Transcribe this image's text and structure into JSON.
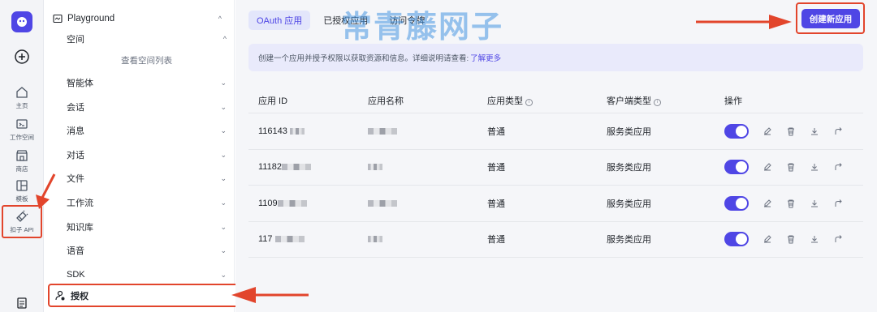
{
  "rail": {
    "items": [
      {
        "label": "主页",
        "icon": "home-icon"
      },
      {
        "label": "工作空间",
        "icon": "terminal-icon"
      },
      {
        "label": "商店",
        "icon": "store-icon"
      },
      {
        "label": "模板",
        "icon": "template-icon"
      },
      {
        "label": "扣子 API",
        "icon": "api-icon"
      }
    ]
  },
  "sidebar": {
    "header": "Playground",
    "items": [
      {
        "label": "空间",
        "caret": "^"
      },
      {
        "label": "智能体",
        "caret": "⌄"
      },
      {
        "label": "会话",
        "caret": "⌄"
      },
      {
        "label": "消息",
        "caret": "⌄"
      },
      {
        "label": "对话",
        "caret": "⌄"
      },
      {
        "label": "文件",
        "caret": "⌄"
      },
      {
        "label": "工作流",
        "caret": "⌄"
      },
      {
        "label": "知识库",
        "caret": "⌄"
      },
      {
        "label": "语音",
        "caret": "⌄"
      },
      {
        "label": "SDK",
        "caret": "⌄"
      }
    ],
    "sub_item": "查看空间列表",
    "auth_label": "授权"
  },
  "main": {
    "tabs": [
      {
        "label": "OAuth 应用"
      },
      {
        "label": "已授权应用"
      },
      {
        "label": "访问令牌"
      }
    ],
    "watermark": "常青藤网子",
    "create_button": "创建新应用",
    "notice_text": "创建一个应用并授予权限以获取资源和信息。详细说明请查看:",
    "notice_link": "了解更多",
    "table": {
      "headers": [
        "应用 ID",
        "应用名称",
        "应用类型",
        "客户端类型",
        "操作"
      ],
      "rows": [
        {
          "id": "116143",
          "name": "",
          "type": "普通",
          "client": "服务类应用"
        },
        {
          "id": "11182",
          "name": "",
          "type": "普通",
          "client": "服务类应用"
        },
        {
          "id": "1109",
          "name": "",
          "type": "普通",
          "client": "服务类应用"
        },
        {
          "id": "117",
          "name": "",
          "type": "普通",
          "client": "服务类应用"
        }
      ]
    }
  },
  "colors": {
    "accent": "#4f46e5",
    "highlight": "#e2452c",
    "watermark": "#4696e1"
  }
}
